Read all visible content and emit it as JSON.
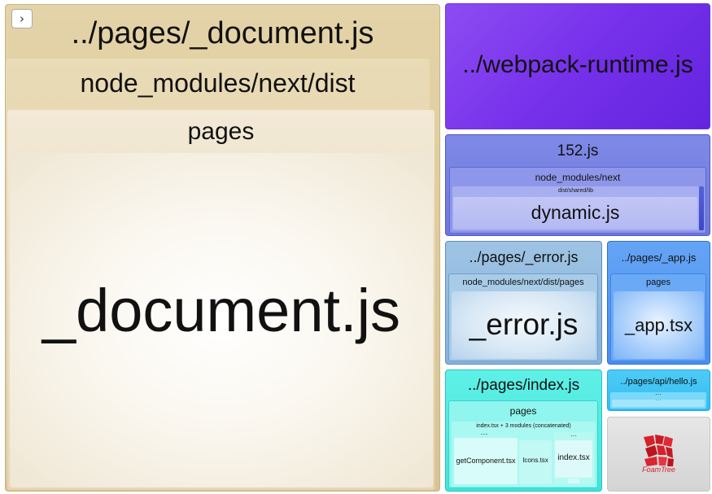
{
  "toggle": {
    "icon": "chevron-right-icon",
    "glyph": "›"
  },
  "document_group": {
    "title": "../pages/_document.js",
    "node_modules": "node_modules/next/dist",
    "pages": "pages",
    "leaf": "_document.js"
  },
  "webpack_runtime": {
    "title": "../webpack-runtime.js"
  },
  "chunk_152": {
    "title": "152.js",
    "node_modules": "node_modules/next",
    "dist": "dist/shared/lib",
    "leaf": "dynamic.js"
  },
  "error_group": {
    "title": "../pages/_error.js",
    "path": "node_modules/next/dist/pages",
    "leaf": "_error.js"
  },
  "app_group": {
    "title": "../pages/_app.js",
    "pages": "pages",
    "leaf": "_app.tsx"
  },
  "index_group": {
    "title": "../pages/index.js",
    "pages": "pages",
    "concat": "index.tsx + 3 modules (concatenated)",
    "concat_more": "···",
    "get_component": "getComponent.tsx",
    "icons": "Icons.tsx",
    "index_more": "···",
    "index_leaf": "index.tsx",
    "index_bottom": "····"
  },
  "hello_group": {
    "title": "../pages/api/hello.js",
    "pages_more": "···",
    "api_more": "···"
  },
  "foamtree": {
    "logo_text": "FoamTree",
    "icon": "foamtree-logo-icon"
  },
  "colors": {
    "document": "#ddc99a",
    "webpack_runtime": "#7a35ec",
    "chunk_152": "#7680e2",
    "error": "#92bbe0",
    "app": "#559af2",
    "index": "#4fe9e0",
    "hello": "#3fc2f4",
    "foamtree_red": "#d6212a"
  }
}
